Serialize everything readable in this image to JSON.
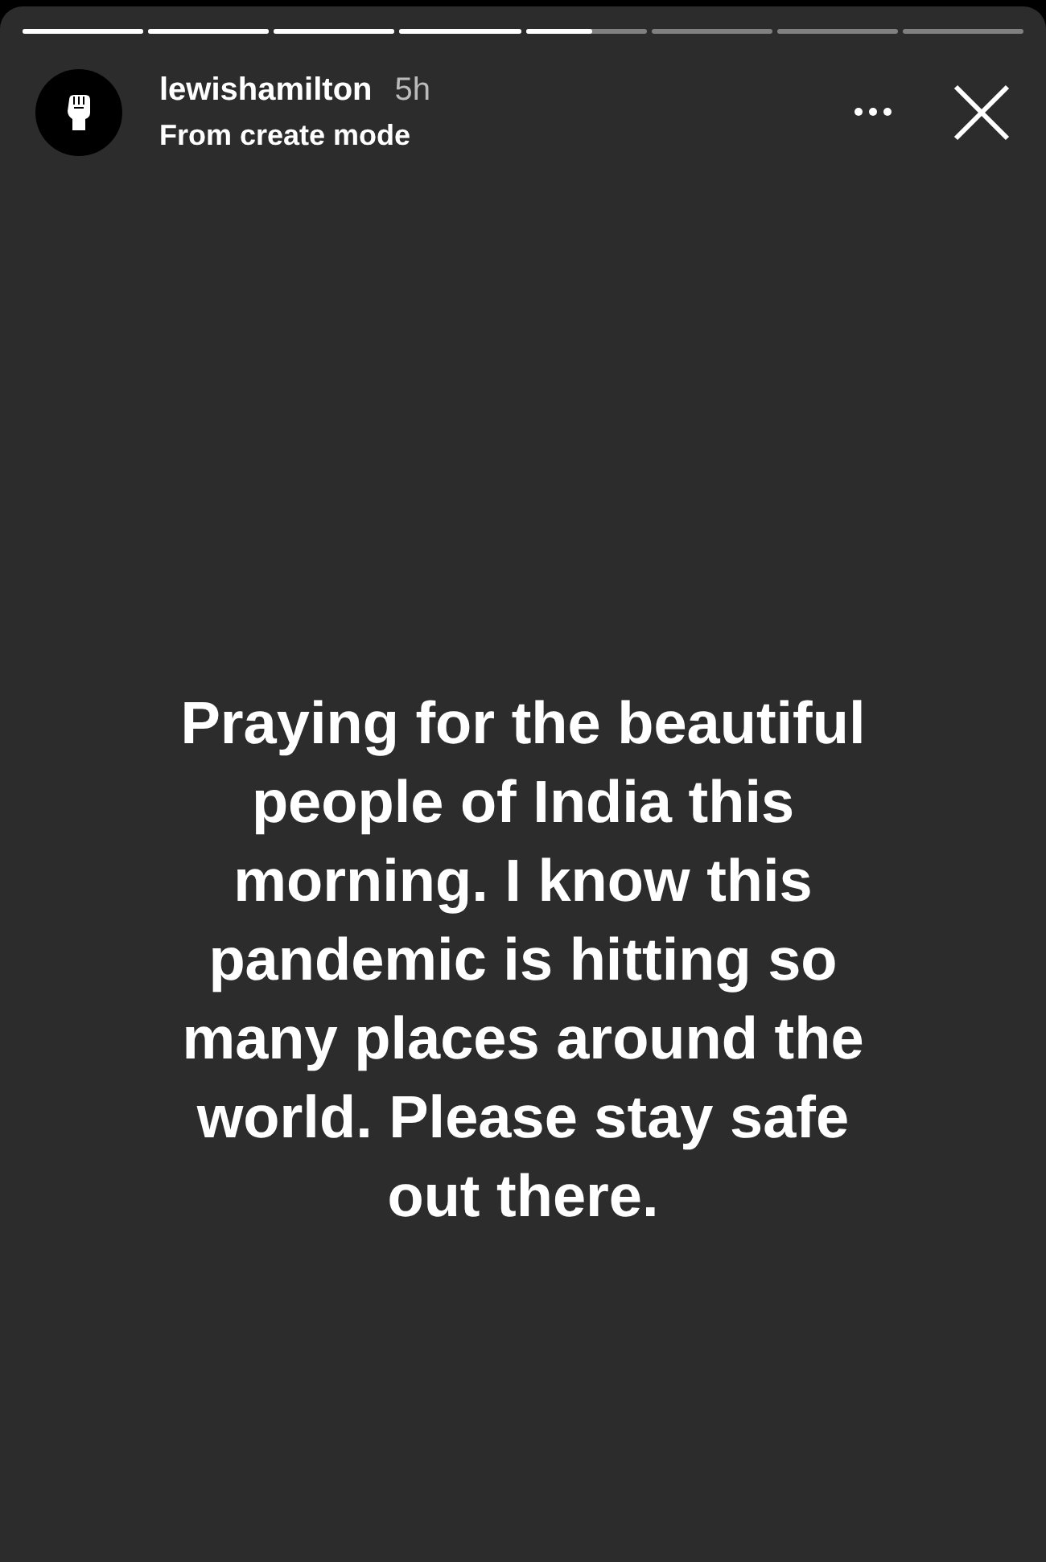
{
  "progress": [
    {
      "level": 1
    },
    {
      "level": 1
    },
    {
      "level": 1
    },
    {
      "level": 1
    },
    {
      "level": 0.55
    },
    {
      "level": 0
    },
    {
      "level": 0
    },
    {
      "level": 0
    }
  ],
  "header": {
    "username": "lewishamilton",
    "time": "5h",
    "subtitle": "From create mode"
  },
  "story": {
    "text": "Praying for the beautiful people of India this morning. I know this pandemic is hitting so many places around the world. Please stay safe out there."
  }
}
